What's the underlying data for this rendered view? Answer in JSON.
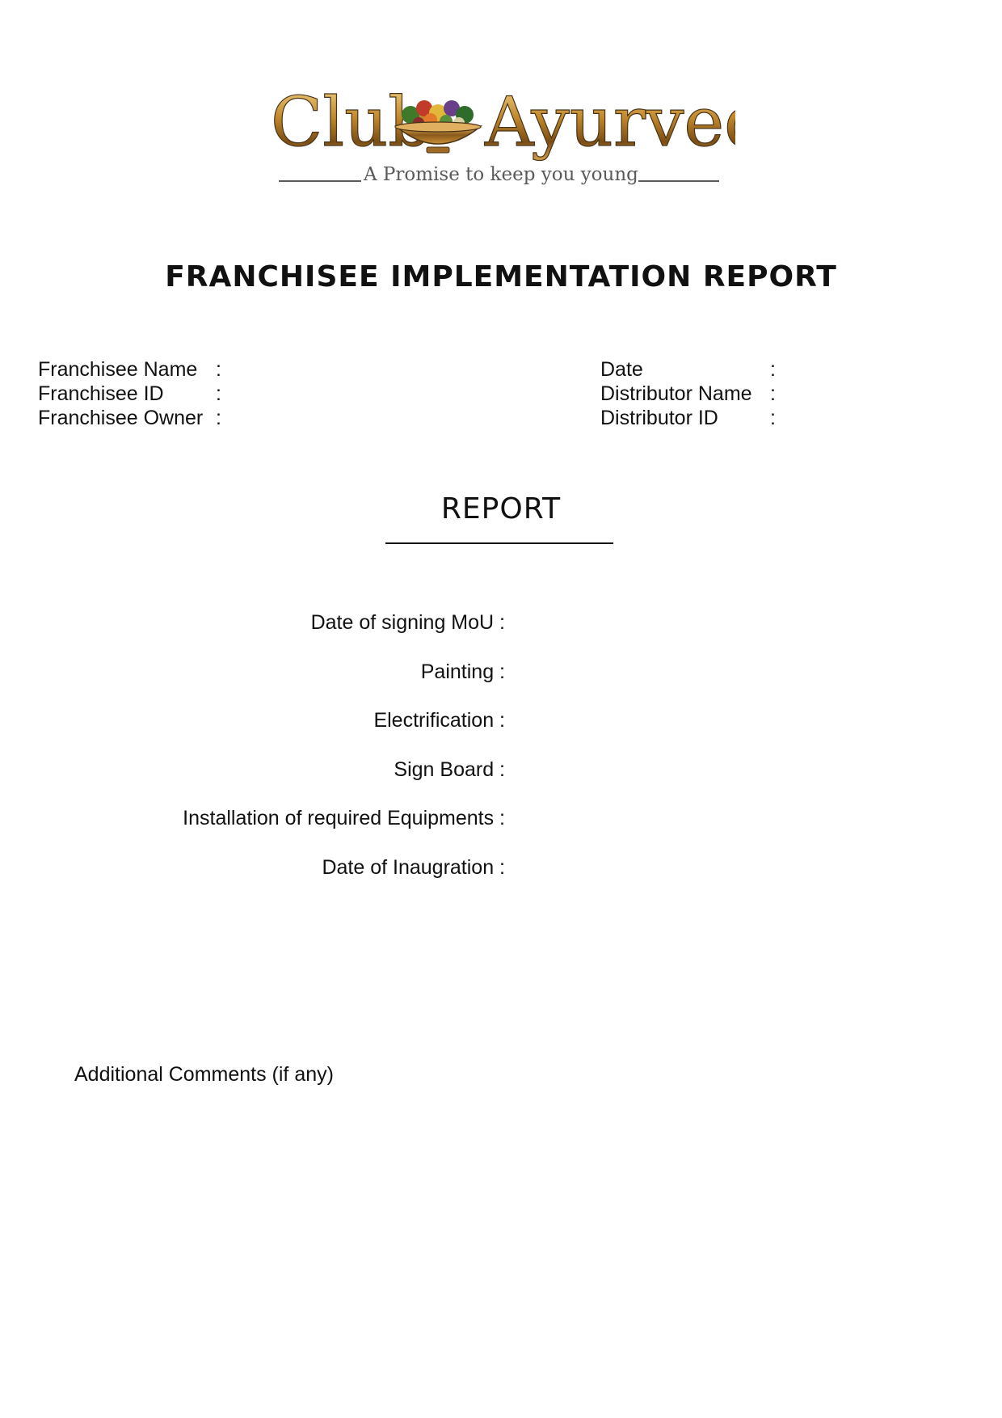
{
  "logo": {
    "brand_left": "Club",
    "brand_right": "Ayurveda",
    "tagline": "A Promise to keep you young"
  },
  "title": "FRANCHISEE IMPLEMENTATION REPORT",
  "info_left": [
    {
      "label": "Franchisee Name",
      "colon": ":"
    },
    {
      "label": "Franchisee ID",
      "colon": ":"
    },
    {
      "label": "Franchisee Owner",
      "colon": ":"
    }
  ],
  "info_right": [
    {
      "label": "Date",
      "colon": ":"
    },
    {
      "label": "Distributor Name",
      "colon": ":"
    },
    {
      "label": "Distributor ID",
      "colon": ":"
    }
  ],
  "report_heading": "REPORT",
  "report_items": [
    "Date of signing MoU :",
    "Painting :",
    "Electrification :",
    "Sign Board :",
    "Installation of required Equipments :",
    "Date of Inaugration :"
  ],
  "comments_label": "Additional Comments (if any)",
  "colors": {
    "text": "#111111",
    "logo_gold": "#b8862b",
    "logo_dark": "#4a3418",
    "tagline": "#5a5a5a"
  }
}
